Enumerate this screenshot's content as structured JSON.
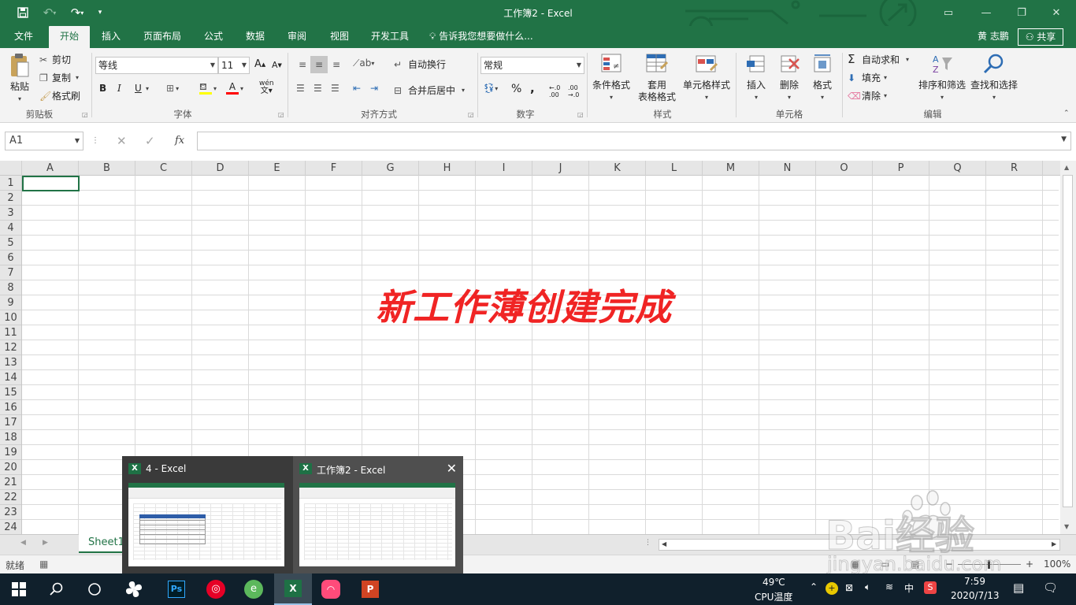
{
  "window": {
    "title": "工作簿2 - Excel",
    "accent": "#217346"
  },
  "tabs": [
    {
      "label": "文件"
    },
    {
      "label": "开始"
    },
    {
      "label": "插入"
    },
    {
      "label": "页面布局"
    },
    {
      "label": "公式"
    },
    {
      "label": "数据"
    },
    {
      "label": "审阅"
    },
    {
      "label": "视图"
    },
    {
      "label": "开发工具"
    }
  ],
  "tell_me": "告诉我您想要做什么...",
  "user": "黄 志鹏",
  "share": "共享",
  "ribbon": {
    "clipboard": {
      "paste": "粘贴",
      "cut": "剪切",
      "copy": "复制",
      "painter": "格式刷",
      "label": "剪贴板"
    },
    "font": {
      "name": "等线",
      "size": "11",
      "grow": "A",
      "shrink": "A",
      "bold": "B",
      "italic": "I",
      "underline": "U",
      "color": "A",
      "phonetic": "wén",
      "label": "字体"
    },
    "align": {
      "wrap": "自动换行",
      "merge": "合并后居中",
      "label": "对齐方式"
    },
    "number": {
      "format": "常规",
      "percent": "%",
      "comma": ",",
      "label": "数字"
    },
    "styles": {
      "cond": "条件格式",
      "table1": "套用",
      "table2": "表格格式",
      "cell": "单元格样式",
      "label": "样式"
    },
    "cells": {
      "insert": "插入",
      "delete": "删除",
      "format": "格式",
      "label": "单元格"
    },
    "editing": {
      "autosum": "自动求和",
      "fill": "填充",
      "clear": "清除",
      "sort": "排序和筛选",
      "find": "查找和选择",
      "label": "编辑"
    }
  },
  "formula_bar": {
    "name_box": "A1",
    "cancel": "✕",
    "enter": "✓",
    "fx": "fx",
    "value": ""
  },
  "columns": [
    "A",
    "B",
    "C",
    "D",
    "E",
    "F",
    "G",
    "H",
    "I",
    "J",
    "K",
    "L",
    "M",
    "N",
    "O",
    "P",
    "Q",
    "R"
  ],
  "rows": [
    "1",
    "2",
    "3",
    "4",
    "5",
    "6",
    "7",
    "8",
    "9",
    "10",
    "11",
    "12",
    "13",
    "14",
    "15",
    "16",
    "17",
    "18",
    "19",
    "20",
    "21",
    "22",
    "23",
    "24"
  ],
  "overlay_caption": "新工作薄创建完成",
  "sheet_tab": "Sheet1",
  "status": {
    "ready": "就绪",
    "zoom": "100%",
    "zoom_plus": "+"
  },
  "thumbnails": [
    {
      "title": "4 - Excel",
      "icon": "X"
    },
    {
      "title": "工作簿2 - Excel",
      "icon": "X",
      "close": "✕"
    }
  ],
  "taskbar": {
    "cpu_temp": "49℃",
    "cpu_label": "CPU温度",
    "ime": "中",
    "time": "7:59",
    "date": "2020/7/13",
    "apps": [
      "start-icon",
      "search-icon",
      "task-view-icon",
      "pinwheel-app-icon",
      "photoshop-icon",
      "netease-music-icon",
      "browser-icon",
      "excel-icon",
      "meitu-icon",
      "powerpoint-icon"
    ]
  },
  "watermark": {
    "brand": "Bai经验",
    "url": "jingyan.baidu.com"
  }
}
